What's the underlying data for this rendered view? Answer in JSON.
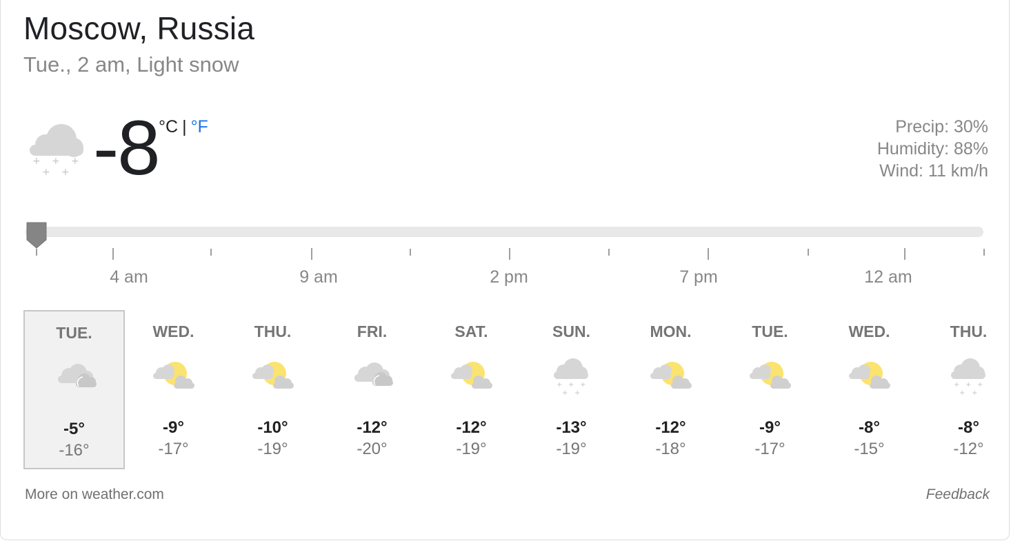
{
  "header": {
    "location": "Moscow, Russia",
    "subtitle": "Tue., 2 am, Light snow"
  },
  "current": {
    "temperature": "-8",
    "icon": "light-snow-cloud-icon",
    "unit_c": "°C",
    "unit_separator": "|",
    "unit_f": "°F",
    "precip": "Precip: 30%",
    "humidity": "Humidity: 88%",
    "wind": "Wind: 11 km/h"
  },
  "timeline": {
    "labels": [
      "4 am",
      "9 am",
      "2 pm",
      "7 pm",
      "12 am"
    ],
    "slider_position": 0
  },
  "forecast": [
    {
      "day": "TUE.",
      "icon": "cloudy-icon",
      "high": "-5°",
      "low": "-16°",
      "selected": true
    },
    {
      "day": "WED.",
      "icon": "partly-sunny-icon",
      "high": "-9°",
      "low": "-17°"
    },
    {
      "day": "THU.",
      "icon": "partly-sunny-icon",
      "high": "-10°",
      "low": "-19°"
    },
    {
      "day": "FRI.",
      "icon": "cloudy-icon",
      "high": "-12°",
      "low": "-20°"
    },
    {
      "day": "SAT.",
      "icon": "partly-sunny-icon",
      "high": "-12°",
      "low": "-19°"
    },
    {
      "day": "SUN.",
      "icon": "snow-cloud-icon",
      "high": "-13°",
      "low": "-19°"
    },
    {
      "day": "MON.",
      "icon": "partly-sunny-icon",
      "high": "-12°",
      "low": "-18°"
    },
    {
      "day": "TUE.",
      "icon": "partly-sunny-icon",
      "high": "-9°",
      "low": "-17°"
    },
    {
      "day": "WED.",
      "icon": "partly-sunny-icon",
      "high": "-8°",
      "low": "-15°"
    },
    {
      "day": "THU.",
      "icon": "snow-cloud-icon",
      "high": "-8°",
      "low": "-12°"
    }
  ],
  "footer": {
    "more_link": "More on weather.com",
    "feedback": "Feedback"
  },
  "colors": {
    "accent": "#1a73e8",
    "sun": "#fbe36f",
    "cloud": "#d6d6d6",
    "selected_bg": "#f1f1f1"
  }
}
